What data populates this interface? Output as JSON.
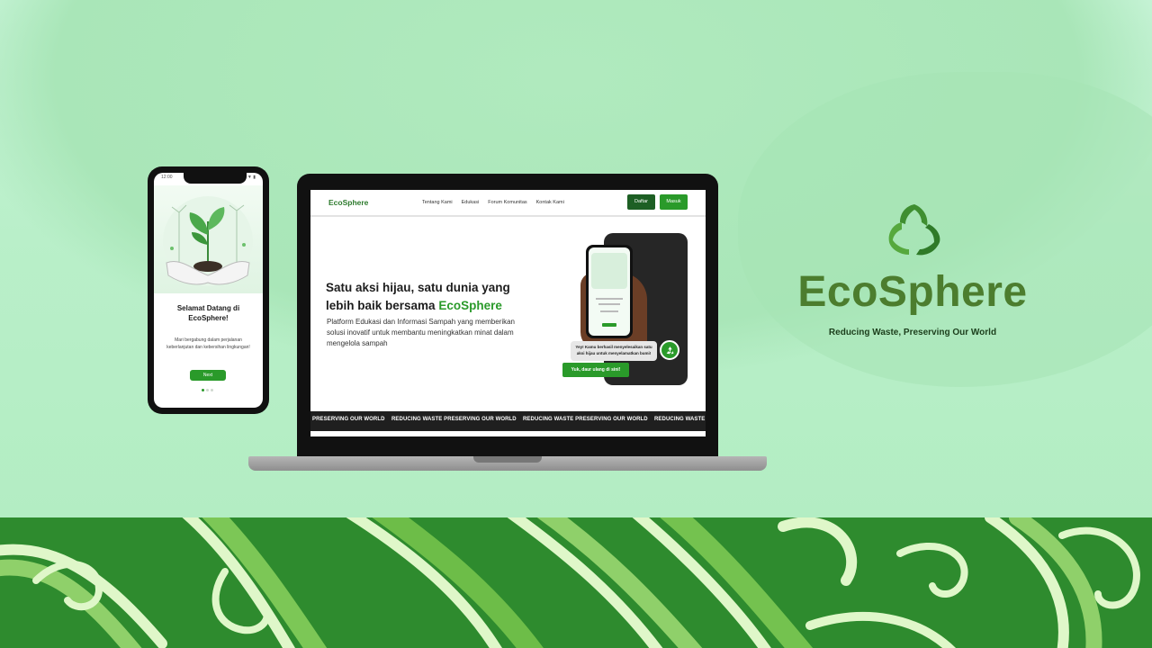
{
  "brand": {
    "name": "EcoSphere",
    "tagline": "Reducing Waste, Preserving Our World",
    "logo_icon": "recycle-leaf-icon",
    "color": "#4c7d2e"
  },
  "phone": {
    "status_time": "12:00",
    "status_icons": "▲ ▼ ▮",
    "title": "Selamat Datang di EcoSphere!",
    "body": "Mari bergabung dalam perjalanan keberlanjutan dan kebersihan lingkungan!",
    "next_label": "Next",
    "illustration_icon": "hands-holding-plant-icon"
  },
  "website": {
    "logo": "EcoSphere",
    "nav": [
      "Tentang Kami",
      "Edukasi",
      "Forum Komunitas",
      "Kontak Kami"
    ],
    "register_label": "Daftar",
    "login_label": "Masuk",
    "hero_title_line1": "Satu aksi hijau, satu dunia yang",
    "hero_title_line2": "lebih baik bersama ",
    "hero_title_accent": "EcoSphere",
    "hero_desc": "Platform Edukasi dan Informasi Sampah yang memberikan solusi inovatif untuk membantu meningkatkan minat dalam mengelola sampah",
    "bubble_text": "Yey! Kamu berhasil menyelesaikan satu aksi hijau untuk menyelamatkan bumi!",
    "cta_label": "Yuk, daur ulang di sini!",
    "ticker_items": [
      "PRESERVING OUR WORLD",
      "REDUCING WASTE PRESERVING OUR WORLD",
      "REDUCING WASTE PRESERVING OUR WORLD",
      "REDUCING WASTE"
    ]
  },
  "colors": {
    "accent_green": "#2a9a2a",
    "dark_green": "#1d5f24",
    "band_green": "#2e8b2e",
    "background": "#c4f0d2"
  }
}
